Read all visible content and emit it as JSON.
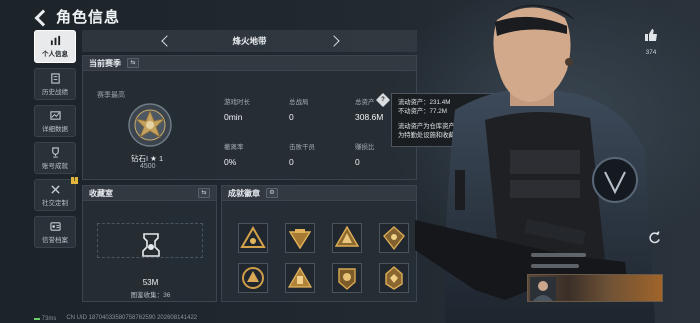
{
  "header": {
    "title": "角色信息"
  },
  "nav_tabs": [
    {
      "label": "个人信息",
      "icon": "bar-chart-icon",
      "active": true
    },
    {
      "label": "历史战绩",
      "icon": "history-icon"
    },
    {
      "label": "详细数据",
      "icon": "detail-data-icon"
    },
    {
      "label": "账号成就",
      "icon": "achievement-icon"
    },
    {
      "label": "社交定制",
      "icon": "social-custom-icon",
      "notice": "!"
    },
    {
      "label": "信誉档案",
      "icon": "credit-file-icon"
    }
  ],
  "season_selector": {
    "name": "烽火地带"
  },
  "current_season": {
    "title": "当前赛季",
    "rank_caption": "赛季最高",
    "rank_name": "钻石I ★ 1",
    "rank_score": "4500",
    "stats": [
      {
        "label": "游戏时长",
        "value": "0min"
      },
      {
        "label": "总战局",
        "value": "0"
      },
      {
        "label": "总资产",
        "value": "308.6M"
      },
      {
        "label": "撤离率",
        "value": "0%"
      },
      {
        "label": "击败干员",
        "value": "0"
      },
      {
        "label": "赚损比",
        "value": "0"
      }
    ]
  },
  "tooltip": {
    "liquid": "流动资产：231.4M",
    "fixed": "不动资产：77.2M",
    "desc1": "流动资产为仓库资产和哈夫币，不动资产",
    "desc2": "为特勤处设施和收藏室设施"
  },
  "vault": {
    "title": "收藏室",
    "amount": "53M",
    "collection": "图鉴收集：36"
  },
  "badges": {
    "title": "成就徽章",
    "count": 8
  },
  "likes": {
    "count": "374"
  },
  "footer": {
    "ping": "73ms",
    "uid": "CN UID 18704033580758762590 202608141422"
  },
  "colors": {
    "accent": "#e2b53c",
    "panel": "#282f36",
    "text": "#d8dde2"
  }
}
